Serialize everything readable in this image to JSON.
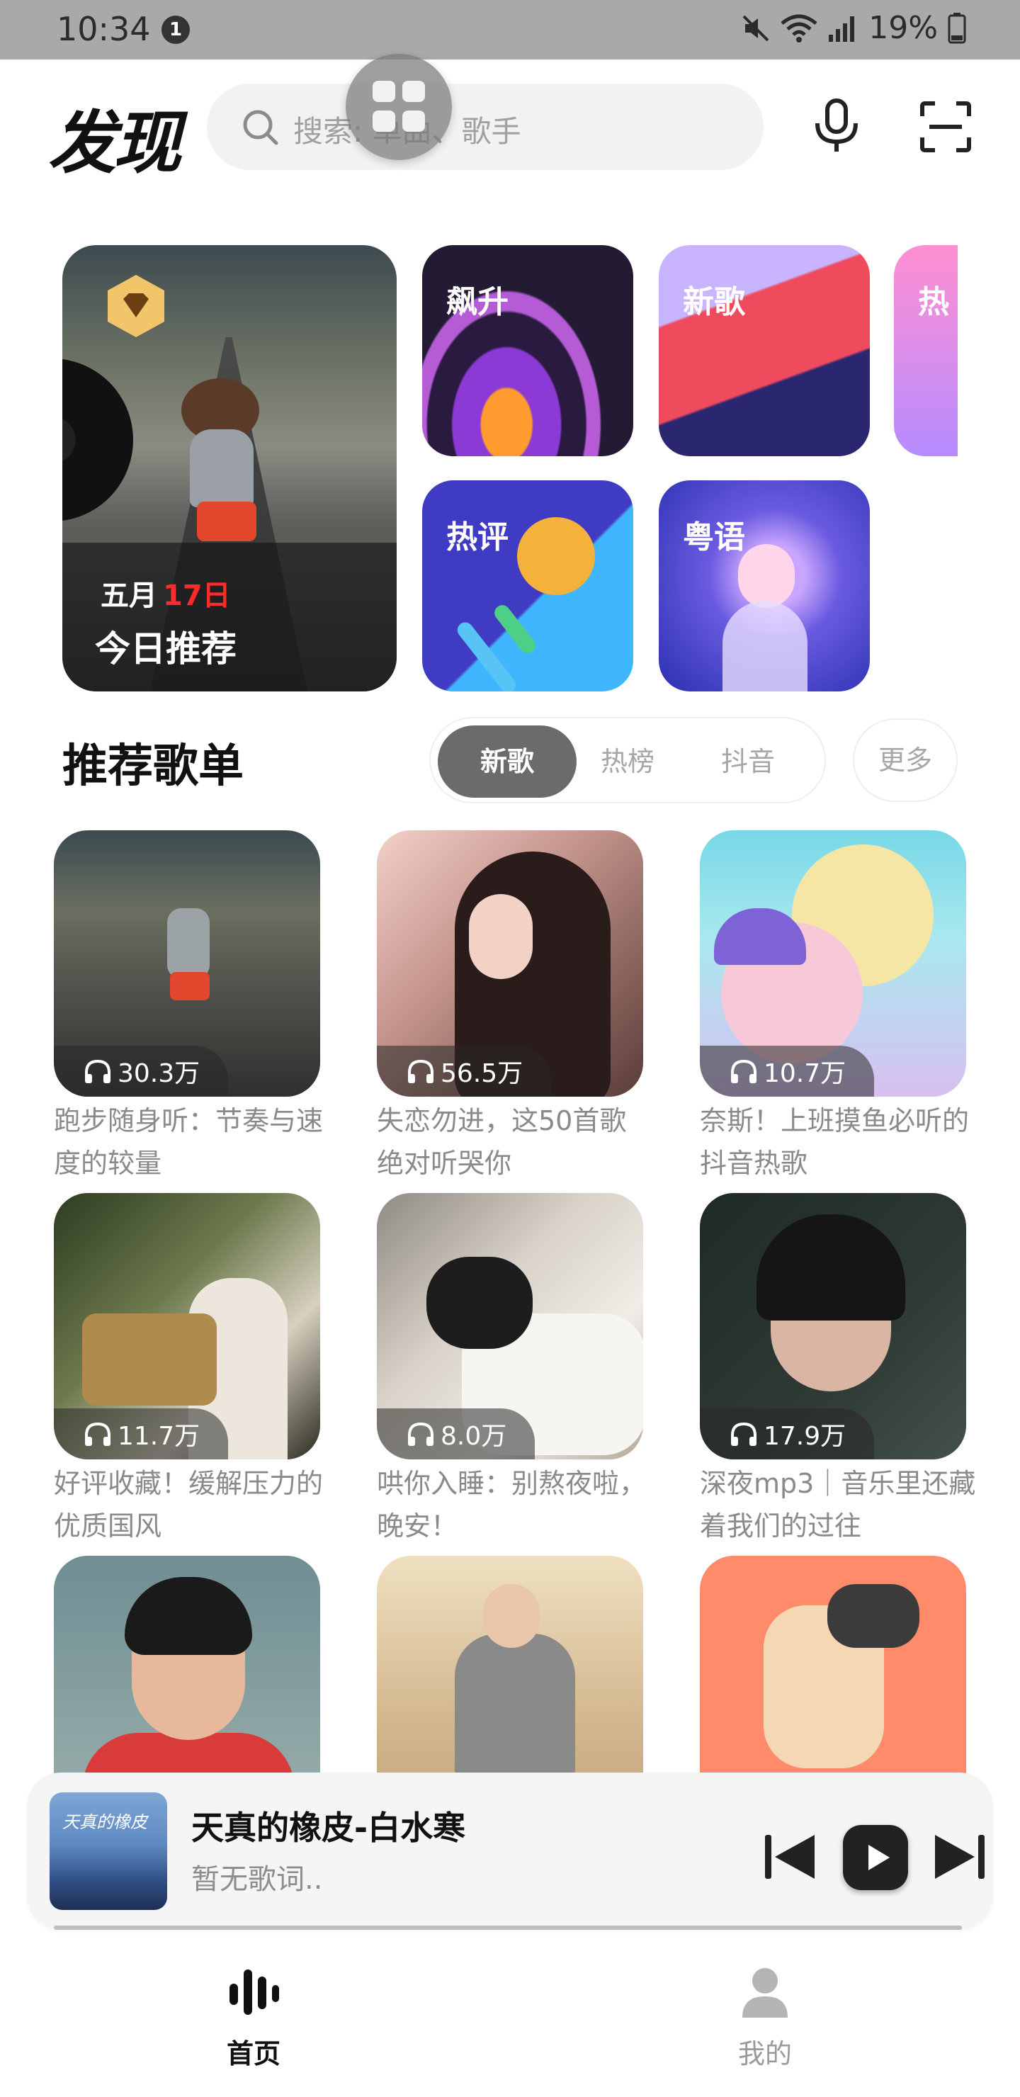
{
  "status_bar": {
    "time": "10:34",
    "notification_count": "1",
    "battery": "19%"
  },
  "header": {
    "title": "发现",
    "search_placeholder": "搜索: 单曲、歌手"
  },
  "featured": {
    "daily": {
      "month": "五月",
      "day": "17日",
      "title": "今日推荐"
    },
    "categories": [
      {
        "label": "飙升"
      },
      {
        "label": "新歌"
      },
      {
        "label": "热"
      },
      {
        "label": "热评"
      },
      {
        "label": "粤语"
      }
    ]
  },
  "playlists_section": {
    "title": "推荐歌单",
    "tabs": [
      "新歌",
      "热榜",
      "抖音"
    ],
    "active_tab": "新歌",
    "more_label": "更多",
    "items": [
      {
        "count": "30.3万",
        "title": "跑步随身听：节奏与速度的较量"
      },
      {
        "count": "56.5万",
        "title": "失恋勿进，这50首歌绝对听哭你"
      },
      {
        "count": "10.7万",
        "title": "奈斯！上班摸鱼必听的抖音热歌"
      },
      {
        "count": "11.7万",
        "title": "好评收藏！缓解压力的优质国风"
      },
      {
        "count": "8.0万",
        "title": "哄你入睡：别熬夜啦，晚安！"
      },
      {
        "count": "17.9万",
        "title": "深夜mp3｜音乐里还藏着我们的过往"
      }
    ]
  },
  "mini_player": {
    "song_title": "天真的橡皮-白水寒",
    "lyrics_status": "暂无歌词..",
    "cover_text": "天真的橡皮"
  },
  "bottom_nav": {
    "home_label": "首页",
    "mine_label": "我的"
  },
  "colors": {
    "accent_red": "#ff2a2a",
    "active_tab_bg": "#6b6b6b"
  }
}
